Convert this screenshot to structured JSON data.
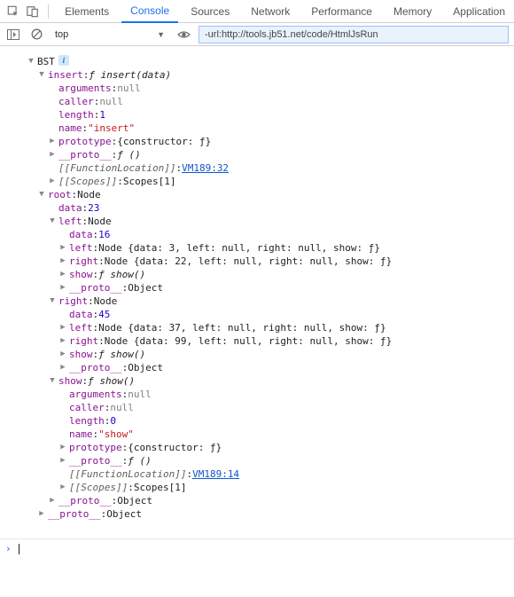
{
  "tabs": {
    "elements": "Elements",
    "console": "Console",
    "sources": "Sources",
    "network": "Network",
    "performance": "Performance",
    "memory": "Memory",
    "application": "Application",
    "active": "console"
  },
  "toolbar": {
    "context": "top",
    "filter": "-url:http://tools.jb51.net/code/HtmlJsRun"
  },
  "tree": {
    "rootName": "BST",
    "insert": {
      "key": "insert",
      "sig": "ƒ insert(data)",
      "arguments": {
        "k": "arguments",
        "v": "null"
      },
      "caller": {
        "k": "caller",
        "v": "null"
      },
      "length": {
        "k": "length",
        "v": "1"
      },
      "name": {
        "k": "name",
        "v": "\"insert\""
      },
      "prototype": {
        "k": "prototype",
        "v": "{constructor: ƒ}"
      },
      "proto": {
        "k": "__proto__",
        "v": "ƒ ()"
      },
      "funcloc": {
        "k": "[[FunctionLocation]]",
        "v": "VM189:32"
      },
      "scopes": {
        "k": "[[Scopes]]",
        "v": "Scopes[1]"
      }
    },
    "root": {
      "key": "root",
      "type": "Node",
      "data": {
        "k": "data",
        "v": "23"
      },
      "left": {
        "key": "left",
        "type": "Node",
        "data": {
          "k": "data",
          "v": "16"
        },
        "leftLeaf": {
          "k": "left",
          "v": "Node {data: 3, left: null, right: null, show: ƒ}"
        },
        "rightLeaf": {
          "k": "right",
          "v": "Node {data: 22, left: null, right: null, show: ƒ}"
        },
        "show": {
          "k": "show",
          "v": "ƒ show()"
        },
        "proto": {
          "k": "__proto__",
          "v": "Object"
        }
      },
      "right": {
        "key": "right",
        "type": "Node",
        "data": {
          "k": "data",
          "v": "45"
        },
        "leftLeaf": {
          "k": "left",
          "v": "Node {data: 37, left: null, right: null, show: ƒ}"
        },
        "rightLeaf": {
          "k": "right",
          "v": "Node {data: 99, left: null, right: null, show: ƒ}"
        },
        "show": {
          "k": "show",
          "v": "ƒ show()"
        },
        "proto": {
          "k": "__proto__",
          "v": "Object"
        }
      },
      "show": {
        "key": "show",
        "sig": "ƒ show()",
        "arguments": {
          "k": "arguments",
          "v": "null"
        },
        "caller": {
          "k": "caller",
          "v": "null"
        },
        "length": {
          "k": "length",
          "v": "0"
        },
        "name": {
          "k": "name",
          "v": "\"show\""
        },
        "prototype": {
          "k": "prototype",
          "v": "{constructor: ƒ}"
        },
        "proto": {
          "k": "__proto__",
          "v": "ƒ ()"
        },
        "funcloc": {
          "k": "[[FunctionLocation]]",
          "v": "VM189:14"
        },
        "scopes": {
          "k": "[[Scopes]]",
          "v": "Scopes[1]"
        }
      },
      "proto": {
        "k": "__proto__",
        "v": "Object"
      }
    },
    "proto": {
      "k": "__proto__",
      "v": "Object"
    }
  },
  "chart_data": {
    "type": "table",
    "title": "Binary Search Tree console dump",
    "nodes": [
      {
        "path": "root",
        "data": 23
      },
      {
        "path": "root.left",
        "data": 16
      },
      {
        "path": "root.left.left",
        "data": 3,
        "left": null,
        "right": null
      },
      {
        "path": "root.left.right",
        "data": 22,
        "left": null,
        "right": null
      },
      {
        "path": "root.right",
        "data": 45
      },
      {
        "path": "root.right.left",
        "data": 37,
        "left": null,
        "right": null
      },
      {
        "path": "root.right.right",
        "data": 99,
        "left": null,
        "right": null
      }
    ]
  }
}
